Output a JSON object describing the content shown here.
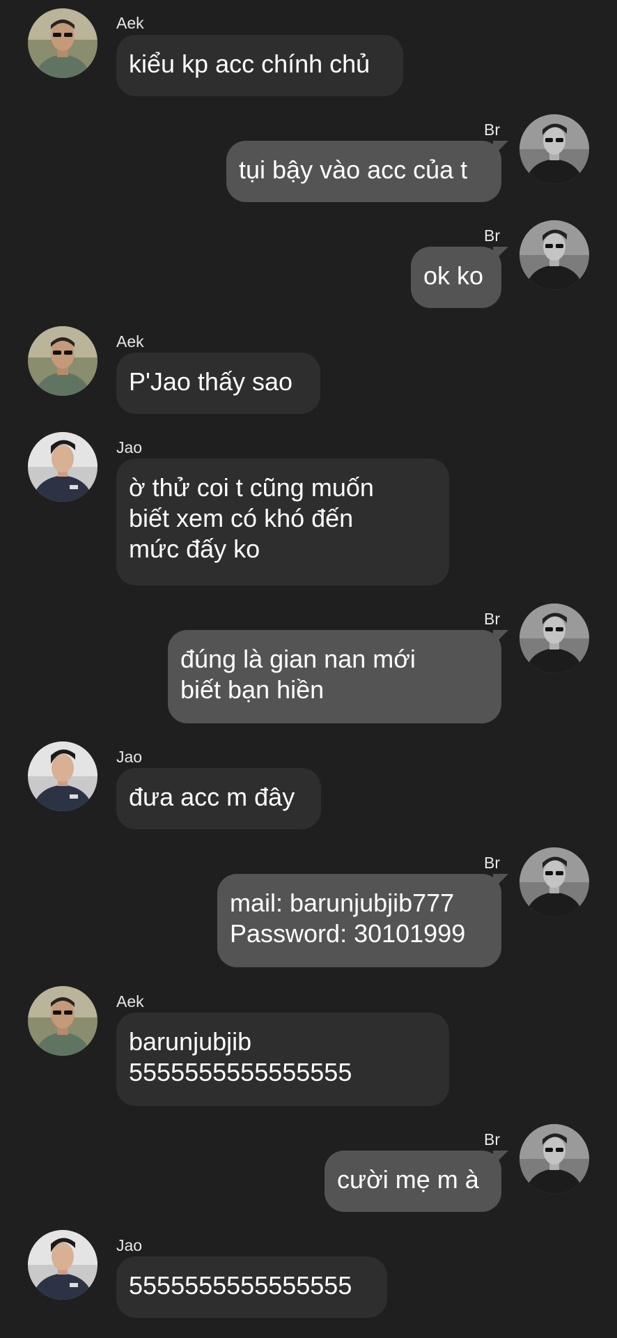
{
  "colors": {
    "background": "#1f1f1f",
    "incoming_bubble": "#2e2e2e",
    "outgoing_bubble": "#545454",
    "text": "#ffffff"
  },
  "messages": [
    {
      "sender": "Aek",
      "text": "kiểu kp acc chính chủ",
      "avatar": "aek-avatar"
    },
    {
      "sender": "Br",
      "text": "tụi bậy vào acc của t",
      "avatar": "br-avatar"
    },
    {
      "sender": "Br",
      "text": "ok ko",
      "avatar": "br-avatar"
    },
    {
      "sender": "Aek",
      "text": "P'Jao thấy sao",
      "avatar": "aek-avatar"
    },
    {
      "sender": "Jao",
      "text": "ờ thử coi t cũng muốn\nbiết xem có khó đến\nmức đấy ko",
      "avatar": "jao-avatar"
    },
    {
      "sender": "Br",
      "text": "đúng là gian nan mới\nbiết bạn hiền",
      "avatar": "br-avatar"
    },
    {
      "sender": "Jao",
      "text": "đưa acc m đây",
      "avatar": "jao-avatar"
    },
    {
      "sender": "Br",
      "text": "mail: barunjubjib777\nPassword: 30101999",
      "avatar": "br-avatar"
    },
    {
      "sender": "Aek",
      "text": "barunjubjib\n5555555555555555",
      "avatar": "aek-avatar"
    },
    {
      "sender": "Br",
      "text": "cười mẹ m à",
      "avatar": "br-avatar"
    },
    {
      "sender": "Jao",
      "text": "5555555555555555",
      "avatar": "jao-avatar"
    }
  ]
}
